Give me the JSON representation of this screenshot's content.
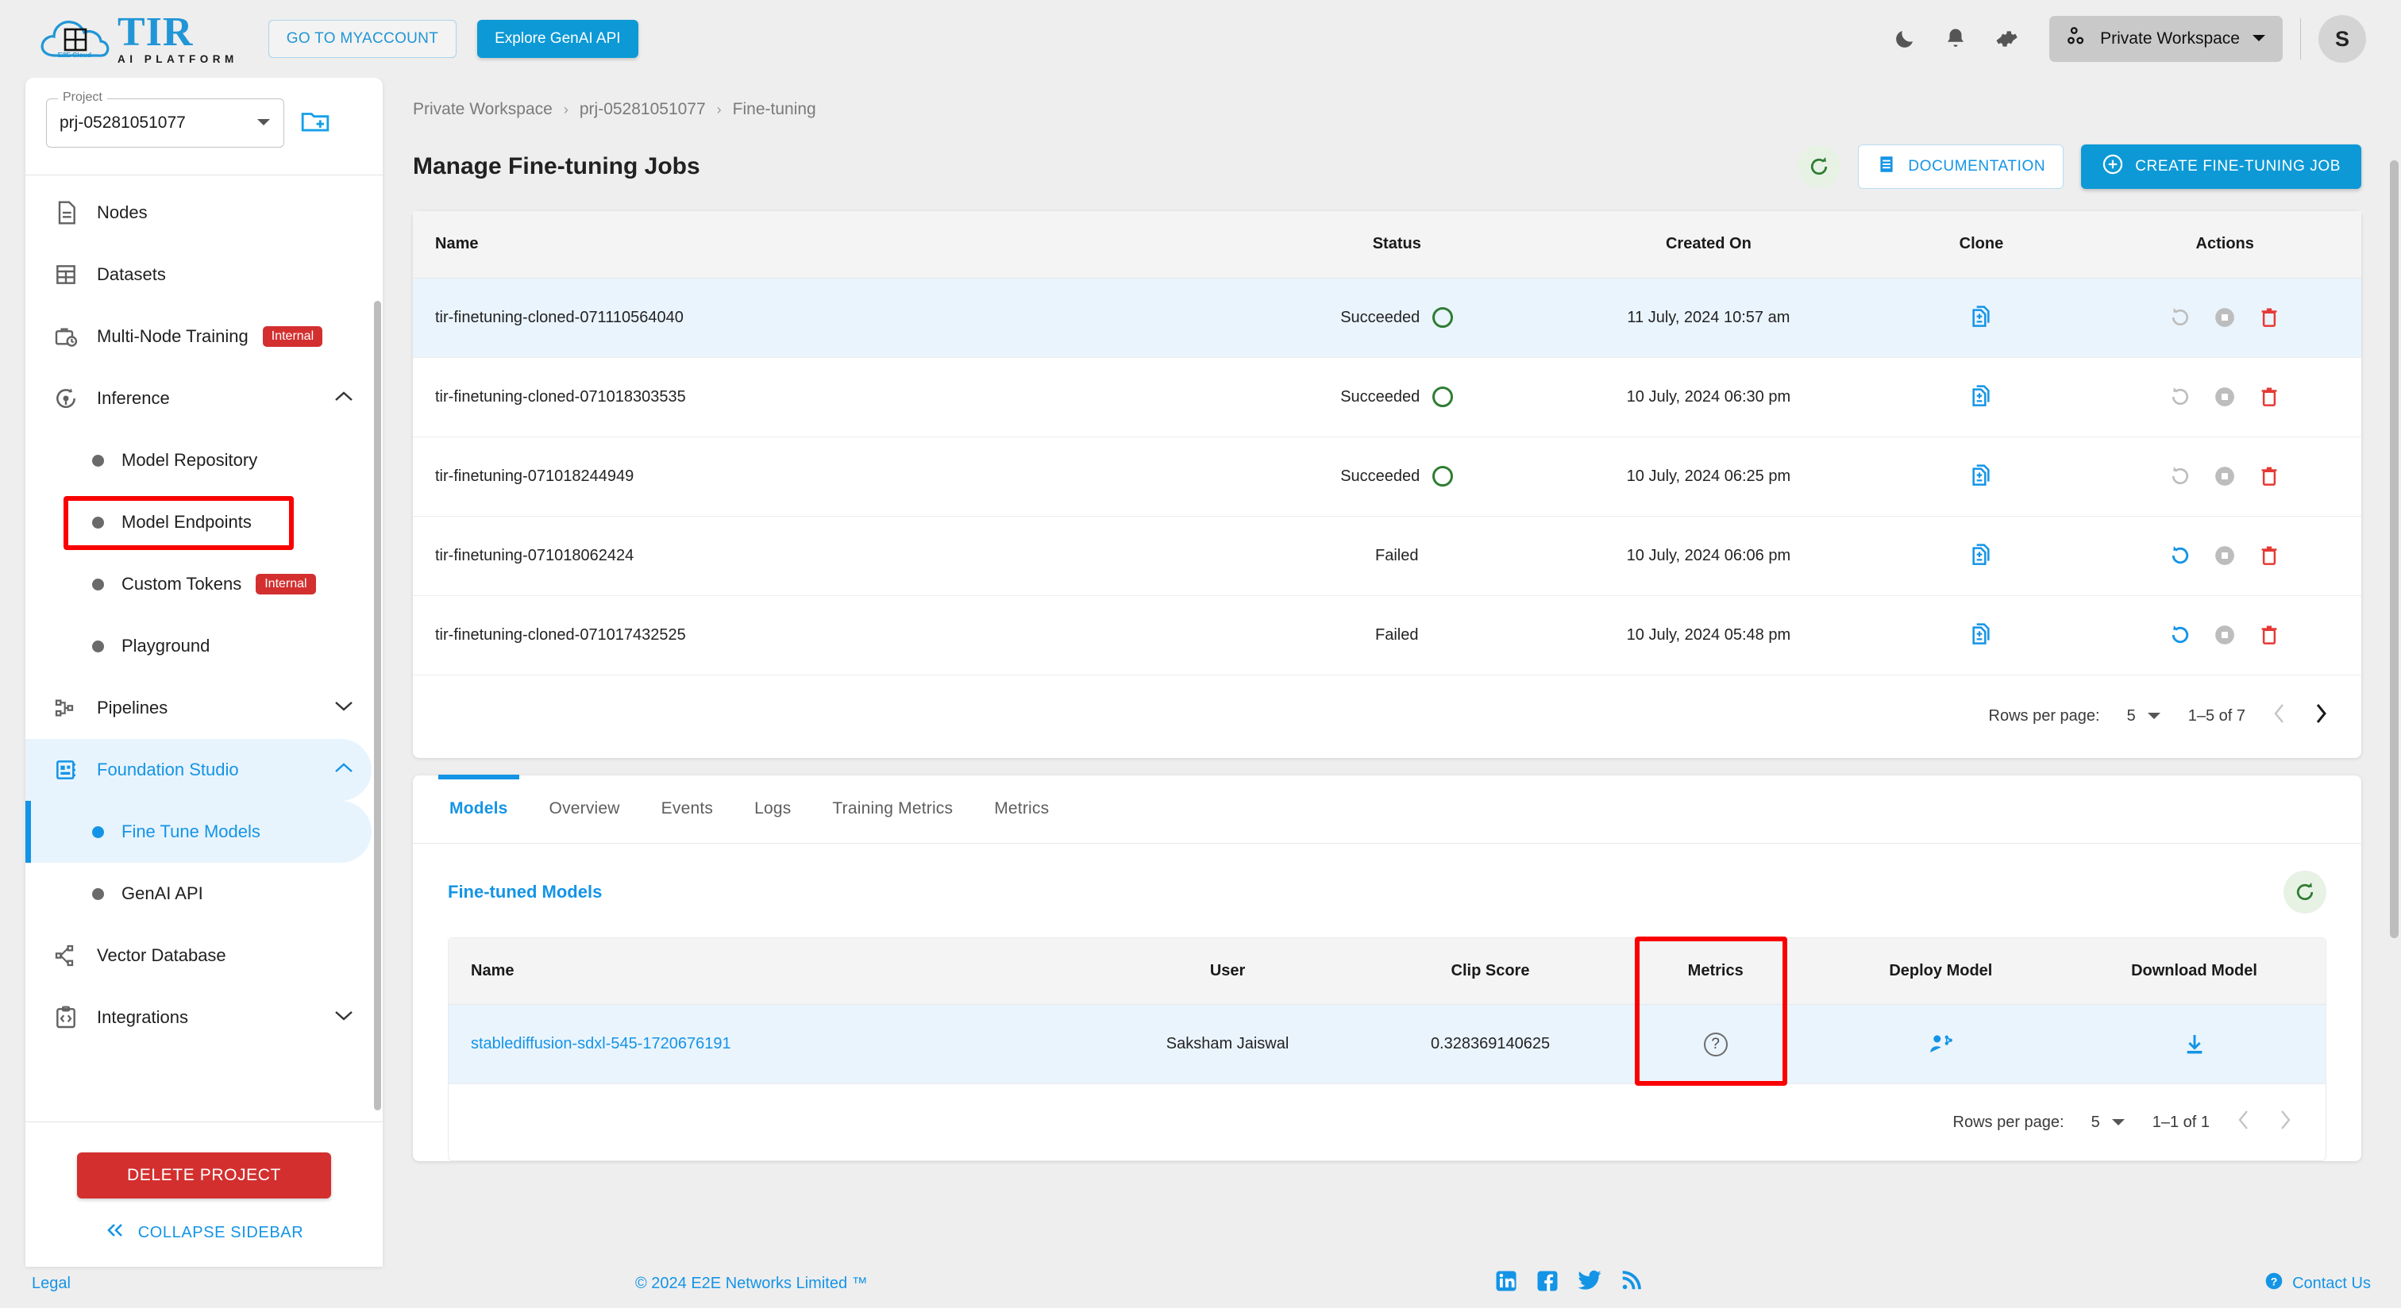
{
  "topbar": {
    "brand_name": "TIR",
    "brand_sub": "AI PLATFORM",
    "brand_cloud_label": "E2E Cloud",
    "myaccount_label": "GO TO MYACCOUNT",
    "genai_label": "Explore GenAI API",
    "dark_mode_icon": "moon-icon",
    "notifications_icon": "bell-icon",
    "settings_icon": "gear-icon",
    "workspace_label": "Private Workspace",
    "workspace_icon": "workspace-dots-icon",
    "avatar_initial": "S"
  },
  "sidebar": {
    "project_label": "Project",
    "project_value": "prj-05281051077",
    "new_project_icon": "new-folder-icon",
    "items": [
      {
        "label": "Nodes",
        "icon": "document-icon",
        "type": "item",
        "expand": "",
        "badge": "",
        "active": false
      },
      {
        "label": "Datasets",
        "icon": "grid-icon",
        "type": "item",
        "expand": "",
        "badge": "",
        "active": false
      },
      {
        "label": "Multi-Node Training",
        "icon": "briefcase-clock-icon",
        "type": "item",
        "expand": "",
        "badge": "Internal",
        "active": false
      },
      {
        "label": "Inference",
        "icon": "inference-icon",
        "type": "item",
        "expand": "up",
        "badge": "",
        "active": false
      },
      {
        "label": "Model Repository",
        "icon": "dot",
        "type": "sub",
        "expand": "",
        "badge": "",
        "active": false
      },
      {
        "label": "Model Endpoints",
        "icon": "dot",
        "type": "sub",
        "expand": "",
        "badge": "",
        "active": false,
        "highlighted": true
      },
      {
        "label": "Custom Tokens",
        "icon": "dot",
        "type": "sub",
        "expand": "",
        "badge": "Internal",
        "active": false
      },
      {
        "label": "Playground",
        "icon": "dot",
        "type": "sub",
        "expand": "",
        "badge": "",
        "active": false
      },
      {
        "label": "Pipelines",
        "icon": "pipeline-icon",
        "type": "item",
        "expand": "down",
        "badge": "",
        "active": false
      },
      {
        "label": "Foundation Studio",
        "icon": "studio-icon",
        "type": "item",
        "expand": "up",
        "badge": "",
        "active": true
      },
      {
        "label": "Fine Tune Models",
        "icon": "dot",
        "type": "sub",
        "expand": "",
        "badge": "",
        "active": true
      },
      {
        "label": "GenAI API",
        "icon": "dot",
        "type": "sub",
        "expand": "",
        "badge": "",
        "active": false
      },
      {
        "label": "Vector Database",
        "icon": "vector-db-icon",
        "type": "item",
        "expand": "",
        "badge": "",
        "active": false
      },
      {
        "label": "Integrations",
        "icon": "integrations-icon",
        "type": "item",
        "expand": "down",
        "badge": "",
        "active": false
      }
    ],
    "delete_project_label": "DELETE PROJECT",
    "collapse_label": "COLLAPSE SIDEBAR",
    "collapse_icon": "double-chevron-left-icon"
  },
  "breadcrumb": [
    "Private Workspace",
    "prj-05281051077",
    "Fine-tuning"
  ],
  "page": {
    "title": "Manage Fine-tuning Jobs",
    "refresh_icon": "refresh-icon",
    "documentation_label": "DOCUMENTATION",
    "documentation_icon": "doc-list-icon",
    "create_label": "CREATE FINE-TUNING JOB",
    "create_icon": "plus-circle-icon"
  },
  "jobs_table": {
    "columns": [
      "Name",
      "Status",
      "Created On",
      "Clone",
      "Actions"
    ],
    "rows": [
      {
        "name": "tir-finetuning-cloned-071110564040",
        "status": "Succeeded",
        "created_on": "11 July, 2024 10:57 am",
        "restart_enabled": false,
        "highlighted": true
      },
      {
        "name": "tir-finetuning-cloned-071018303535",
        "status": "Succeeded",
        "created_on": "10 July, 2024 06:30 pm",
        "restart_enabled": false,
        "highlighted": false
      },
      {
        "name": "tir-finetuning-071018244949",
        "status": "Succeeded",
        "created_on": "10 July, 2024 06:25 pm",
        "restart_enabled": false,
        "highlighted": false
      },
      {
        "name": "tir-finetuning-071018062424",
        "status": "Failed",
        "created_on": "10 July, 2024 06:06 pm",
        "restart_enabled": true,
        "highlighted": false
      },
      {
        "name": "tir-finetuning-cloned-071017432525",
        "status": "Failed",
        "created_on": "10 July, 2024 05:48 pm",
        "restart_enabled": true,
        "highlighted": false
      }
    ],
    "clone_icon": "clone-document-icon",
    "restart_icon": "restart-icon",
    "stop_icon": "stop-icon",
    "delete_icon": "trash-icon",
    "pagination": {
      "rows_per_page_label": "Rows per page:",
      "rows_per_page_value": "5",
      "range_label": "1–5 of 7",
      "prev_icon": "chevron-left-icon",
      "next_icon": "chevron-right-icon"
    }
  },
  "tabs": [
    {
      "label": "Models",
      "selected": true
    },
    {
      "label": "Overview",
      "selected": false
    },
    {
      "label": "Events",
      "selected": false
    },
    {
      "label": "Logs",
      "selected": false
    },
    {
      "label": "Training Metrics",
      "selected": false
    },
    {
      "label": "Metrics",
      "selected": false
    }
  ],
  "models_section": {
    "title": "Fine-tuned Models",
    "refresh_icon": "refresh-icon",
    "columns": [
      "Name",
      "User",
      "Clip Score",
      "Metrics",
      "Deploy Model",
      "Download Model"
    ],
    "rows": [
      {
        "name": "stablediffusion-sdxl-545-1720676191",
        "user": "Saksham Jaiswal",
        "clip_score": "0.328369140625",
        "metrics_icon": "question-mark-icon",
        "deploy_icon": "deploy-model-icon",
        "download_icon": "download-icon"
      }
    ],
    "deploy_column_highlighted": true,
    "pagination": {
      "rows_per_page_label": "Rows per page:",
      "rows_per_page_value": "5",
      "range_label": "1–1 of 1",
      "prev_icon": "chevron-left-icon",
      "next_icon": "chevron-right-icon"
    }
  },
  "footer": {
    "legal": "Legal",
    "copyright": "© 2024 E2E Networks Limited ™",
    "social": [
      "linkedin-icon",
      "facebook-icon",
      "twitter-icon",
      "rss-icon"
    ],
    "contact": "Contact Us",
    "contact_icon": "help-circle-icon"
  },
  "colors": {
    "accent_blue": "#1494e6",
    "brand_blue": "#0d99d6",
    "danger_red": "#d32f2f",
    "highlight_red": "#fb0000",
    "success_green": "#2e7d32",
    "row_highlight": "#eaf4fd"
  }
}
